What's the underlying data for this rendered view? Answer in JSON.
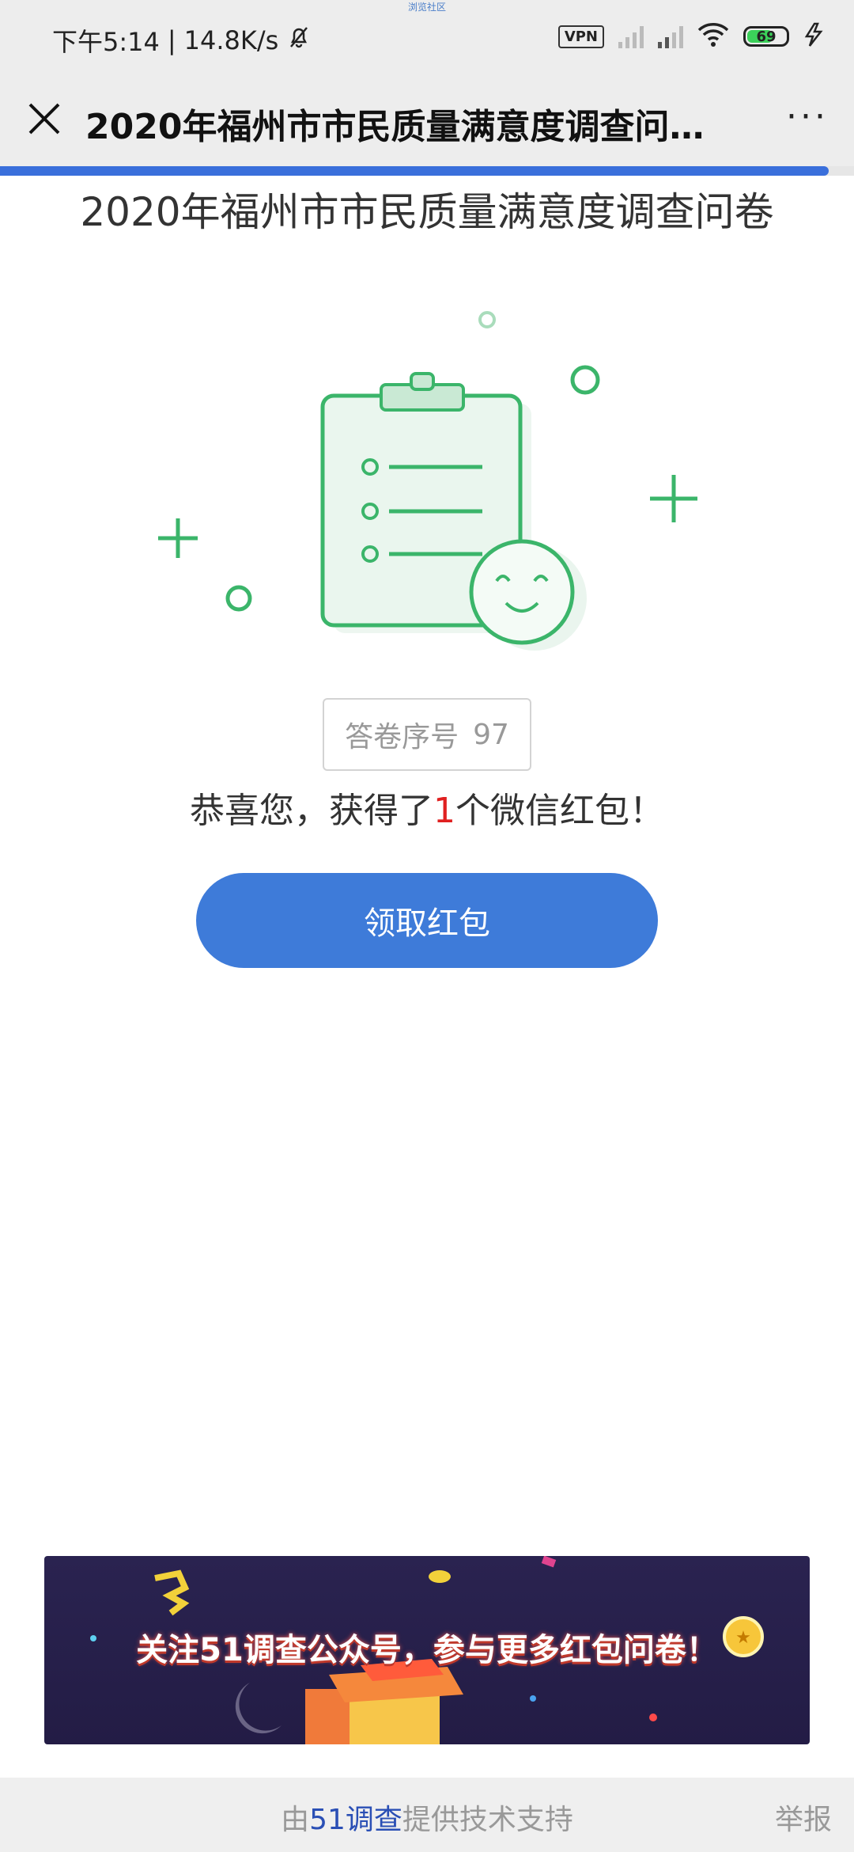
{
  "status_bar": {
    "top_label": "浏览社区",
    "time": "下午5:14",
    "net_speed": "14.8K/s",
    "vpn": "VPN",
    "battery": "69",
    "icons": [
      "bell-off-icon",
      "signal-icon",
      "wifi-icon",
      "battery-icon",
      "charging-icon"
    ]
  },
  "nav": {
    "title": "2020年福州市市民质量满意度调查问…",
    "more": "···"
  },
  "progress": {
    "value": 0.97,
    "color": "#3a6fdb"
  },
  "main": {
    "title": "2020年福州市市民质量满意度调查问卷",
    "serial_label": "答卷序号",
    "serial_number": "97",
    "congrats_prefix": "恭喜您，获得了",
    "congrats_count": "1",
    "congrats_suffix": "个微信红包！",
    "claim_button": "领取红包"
  },
  "banner": {
    "text": "关注51调查公众号，参与更多红包问卷！"
  },
  "footer": {
    "prefix": "由",
    "brand": "51调查",
    "suffix": "提供技术支持",
    "report": "举报"
  },
  "colors": {
    "accent": "#3e7bd9",
    "illustration_green": "#3bb56a",
    "highlight_red": "#e02020"
  }
}
